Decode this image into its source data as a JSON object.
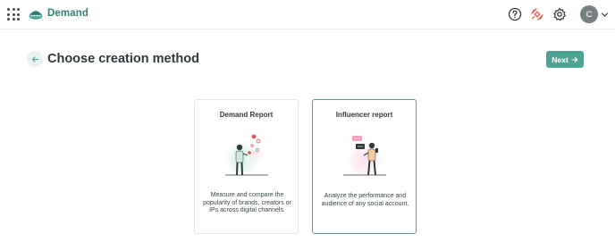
{
  "app": {
    "name": "Demand"
  },
  "header": {
    "avatar_initial": "C"
  },
  "page": {
    "title": "Choose creation method",
    "next_label": "Next"
  },
  "methods": [
    {
      "title": "Demand Report",
      "description": "Measure and compare the popularity of brands, creators or IPs across digital channels.",
      "selected": false
    },
    {
      "title": "Influencer report",
      "description": "Analyze the performance and audience of any social account.",
      "selected": true
    }
  ],
  "colors": {
    "brand": "#2f7d72",
    "accent": "#4da495",
    "back_bg": "#e9f3f1"
  }
}
